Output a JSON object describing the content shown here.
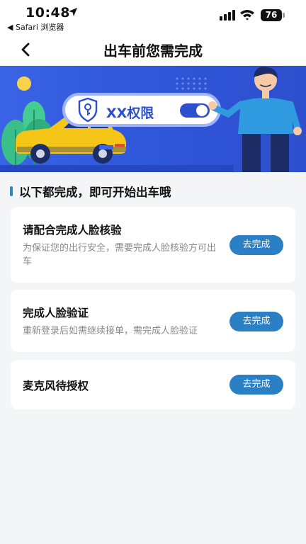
{
  "status_bar": {
    "time": "10:48",
    "back_to_app": "◀ Safari 浏览器",
    "battery": "76"
  },
  "nav": {
    "title": "出车前您需完成"
  },
  "banner": {
    "permission_label": "XX权限"
  },
  "section": {
    "title": "以下都完成，即可开始出车哦"
  },
  "tasks": [
    {
      "title": "请配合完成人脸核验",
      "desc": "为保证您的出行安全，需要完成人脸核验方可出车",
      "button": "去完成"
    },
    {
      "title": "完成人脸验证",
      "desc": "重新登录后如需继续接单，需完成人脸验证",
      "button": "去完成"
    },
    {
      "title": "麦克风待授权",
      "desc": "",
      "button": "去完成"
    }
  ],
  "colors": {
    "accent": "#2b7fc4",
    "banner_bg": "#3a63e6",
    "car_yellow": "#f5c518",
    "page_bg": "#f4f5f7"
  }
}
